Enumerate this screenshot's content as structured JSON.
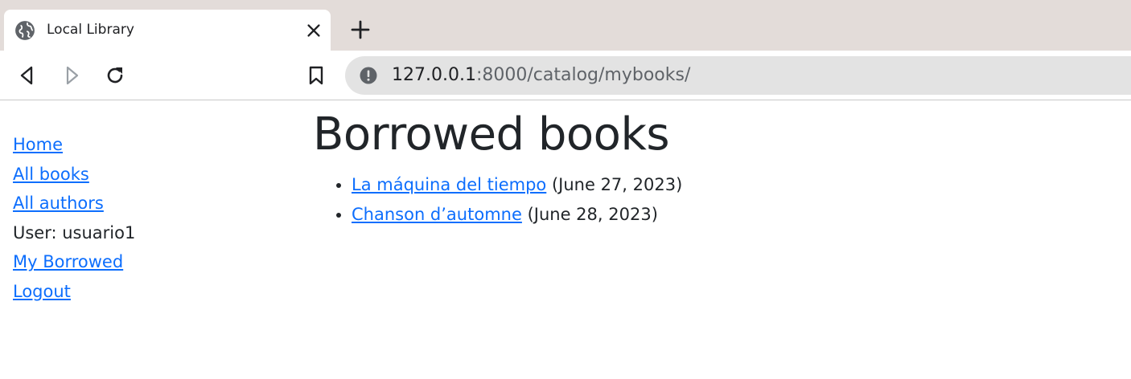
{
  "browser": {
    "tab": {
      "title": "Local Library",
      "favicon": "globe-icon",
      "close_icon": "close-icon"
    },
    "new_tab_icon": "plus-icon",
    "toolbar": {
      "back_icon": "back-arrow-icon",
      "forward_icon": "forward-arrow-icon",
      "reload_icon": "reload-icon",
      "bookmark_icon": "bookmark-icon"
    },
    "omnibox": {
      "security_icon": "info-icon",
      "url_host": "127.0.0.1",
      "url_rest": ":8000/catalog/mybooks/"
    }
  },
  "sidebar": {
    "items": [
      {
        "label": "Home",
        "link": true
      },
      {
        "label": "All books",
        "link": true
      },
      {
        "label": "All authors",
        "link": true
      },
      {
        "label": "User: usuario1",
        "link": false
      },
      {
        "label": "My Borrowed",
        "link": true
      },
      {
        "label": "Logout",
        "link": true
      }
    ]
  },
  "main": {
    "heading": "Borrowed books",
    "books": [
      {
        "title": "La máquina del tiempo",
        "due": "(June 27, 2023)"
      },
      {
        "title": "Chanson d’automne",
        "due": "(June 28, 2023)"
      }
    ]
  },
  "colors": {
    "tabstrip": "#e3dcd9",
    "omnibox": "#e3e3e3",
    "link": "#0d6efd",
    "text": "#212529"
  }
}
